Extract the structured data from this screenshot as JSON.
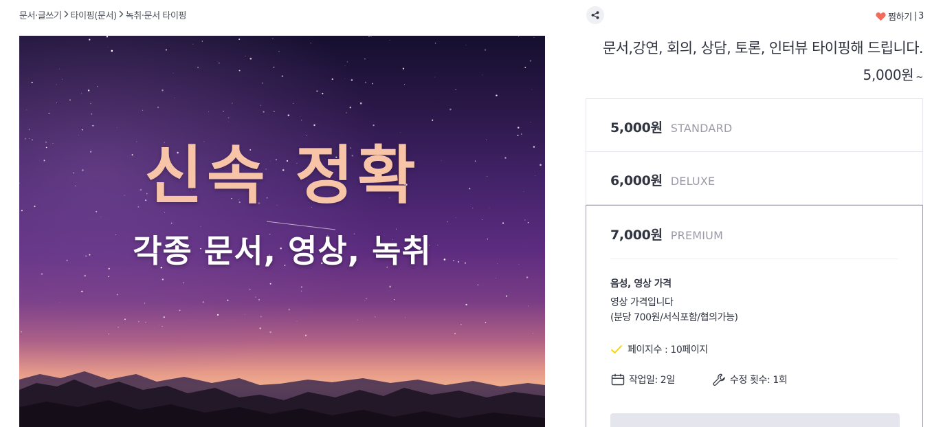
{
  "breadcrumb": {
    "items": [
      "문서·글쓰기",
      "타이핑(문서)",
      "녹취·문서 타이핑"
    ]
  },
  "hero": {
    "title": "신속 정확",
    "subtitle": "각종 문서, 영상, 녹취",
    "title_color": "#f8c4a7",
    "subtitle_color": "#ffffff"
  },
  "header": {
    "share_icon": "share-icon",
    "like_label": "찜하기",
    "like_separator": "|",
    "like_count": "3",
    "heart_color": "#f26b5b"
  },
  "service": {
    "title": "문서,강연, 회의, 상담, 토론, 인터뷰 타이핑해 드립니다.",
    "base_price": "5,000원",
    "base_price_suffix": "~"
  },
  "packages": [
    {
      "price": "5,000원",
      "tier": "STANDARD"
    },
    {
      "price": "6,000원",
      "tier": "DELUXE"
    },
    {
      "price": "7,000원",
      "tier": "PREMIUM",
      "detail_title": "음성, 영상 가격",
      "detail_desc": "영상 가격입니다\n(분당 700원/서식포함/협의가능)",
      "feature": "페이지수 : 10페이지",
      "work_days": "작업일: 2일",
      "revisions": "수정 횟수: 1회"
    }
  ],
  "colors": {
    "text": "#303441",
    "muted": "#9a9ba7",
    "border": "#e4e5ed",
    "check": "#ffd400"
  }
}
